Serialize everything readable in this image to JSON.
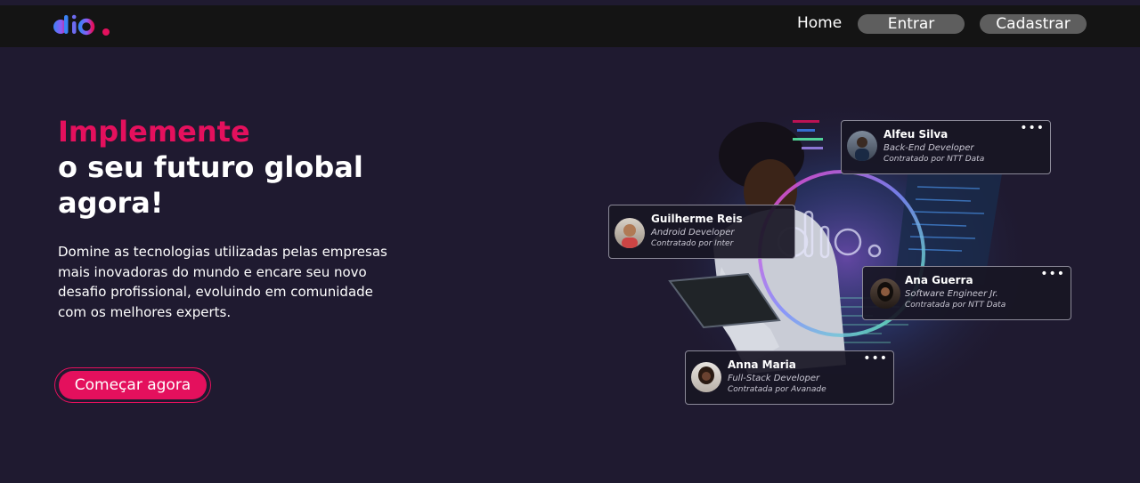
{
  "brand": {
    "logo_name": "dio",
    "accent": "#e4105d",
    "background": "#1f1a30",
    "header_bg": "#141414"
  },
  "nav": {
    "home": "Home",
    "entrar": "Entrar",
    "cadastrar": "Cadastrar"
  },
  "hero": {
    "title_highlight": "Implemente",
    "title_rest": "o seu futuro global agora!",
    "description": "Domine as tecnologias utilizadas pelas empresas mais inovadoras do mundo e encare seu novo desafio profissional, evoluindo em comunidade com os melhores experts.",
    "cta": "Começar agora"
  },
  "profiles": [
    {
      "name": "Alfeu Silva",
      "role": "Back-End Developer",
      "company": "Contratado por NTT Data"
    },
    {
      "name": "Guilherme Reis",
      "role": "Android Developer",
      "company": "Contratado por Inter"
    },
    {
      "name": "Ana Guerra",
      "role": "Software Engineer Jr.",
      "company": "Contratada por NTT Data"
    },
    {
      "name": "Anna Maria",
      "role": "Full-Stack Developer",
      "company": "Contratada por Avanade"
    }
  ],
  "icons": {
    "menu": "more-dots-icon"
  }
}
